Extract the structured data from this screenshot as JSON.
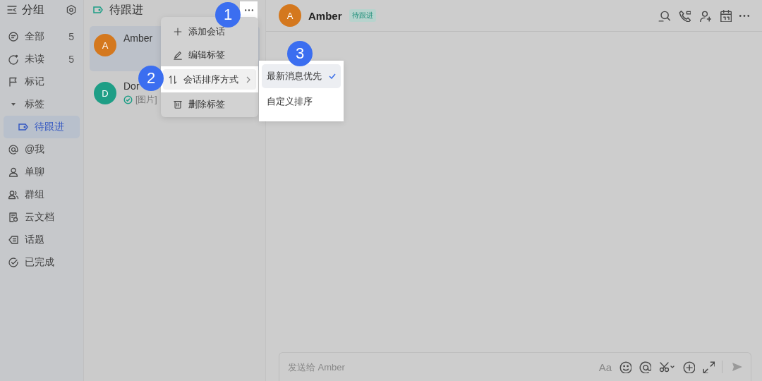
{
  "sidebar": {
    "title": "分组",
    "items": [
      {
        "label": "全部",
        "count": "5",
        "selected": false
      },
      {
        "label": "未读",
        "count": "5",
        "selected": false
      },
      {
        "label": "标记",
        "selected": false
      },
      {
        "label": "标签",
        "selected": false,
        "expanded": true,
        "children": [
          {
            "label": "待跟进",
            "selected": true
          }
        ]
      },
      {
        "label": "@我",
        "selected": false
      },
      {
        "label": "单聊",
        "selected": false
      },
      {
        "label": "群组",
        "selected": false
      },
      {
        "label": "云文档",
        "selected": false
      },
      {
        "label": "话题",
        "selected": false
      },
      {
        "label": "已完成",
        "selected": false
      }
    ]
  },
  "conversation_list": {
    "title": "待跟进",
    "conversations": [
      {
        "avatar": "A",
        "name": "Amber",
        "color": "#d4781e",
        "selected": true
      },
      {
        "avatar": "D",
        "name": "Dor",
        "preview": "[图片]",
        "color": "#1e9e86",
        "selected": false
      }
    ]
  },
  "menu": {
    "items": [
      {
        "label": "添加会话",
        "kind": "item",
        "highlighted": false
      },
      {
        "label": "编辑标签",
        "kind": "item",
        "highlighted": false
      },
      {
        "label": "会话排序方式",
        "kind": "submenu",
        "highlighted": true
      },
      {
        "label": "删除标签",
        "kind": "item",
        "highlighted": false
      }
    ],
    "submenu": [
      {
        "label": "最新消息优先",
        "selected": true
      },
      {
        "label": "自定义排序",
        "selected": false
      }
    ]
  },
  "chat": {
    "avatar": "A",
    "name": "Amber",
    "tag": "待跟进",
    "composer": {
      "placeholder": "发送给 Amber",
      "format_label": "Aa"
    }
  },
  "step_markers": [
    "1",
    "2",
    "3"
  ]
}
